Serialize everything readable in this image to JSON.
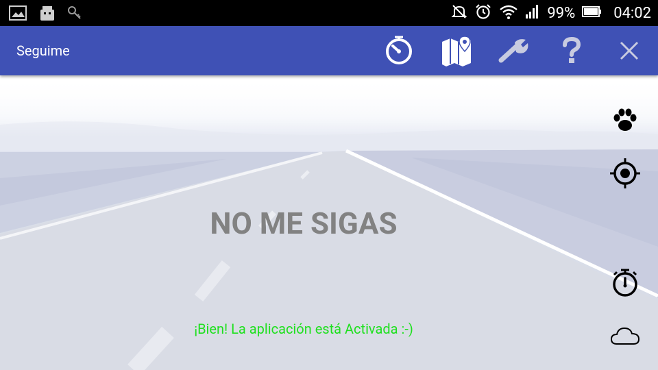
{
  "status_bar": {
    "battery_percent": "99%",
    "time": "04:02",
    "icons": [
      "image-notification-icon",
      "android-notification-icon",
      "key-notification-icon",
      "mute-icon",
      "alarm-icon",
      "wifi-icon",
      "signal-icon",
      "battery-icon"
    ]
  },
  "app_bar": {
    "title": "Seguime",
    "actions": [
      "timer-icon",
      "map-icon",
      "settings-wrench-icon",
      "help-icon",
      "close-icon"
    ],
    "color": "#3f51b5"
  },
  "main": {
    "status_label": "NO ME SIGAS",
    "status_message": "¡Bien! La aplicación está Activada :-)",
    "message_color": "#1fe01f",
    "side_buttons": [
      "paw-icon",
      "crosshair-icon",
      "stopwatch-icon",
      "cloud-icon"
    ]
  }
}
